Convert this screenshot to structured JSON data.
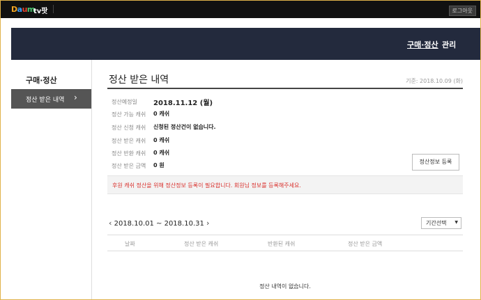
{
  "topbar": {
    "logo_parts": [
      "D",
      "a",
      "u",
      "m"
    ],
    "service_name": "tv팟",
    "logout_label": "로그아웃"
  },
  "header": {
    "nav": [
      "구매·정산",
      "관리"
    ]
  },
  "sidebar": {
    "title": "구매·정산",
    "items": [
      {
        "label": "정산 받은 내역",
        "chevron": "›"
      }
    ]
  },
  "main": {
    "title": "정산 받은 내역",
    "ref_date": "기준: 2018.10.09 (화)",
    "info": [
      {
        "label": "정산예정일",
        "value": "2018.11.12 (월)"
      },
      {
        "label": "정산 가능 캐쉬",
        "value": "0 캐쉬"
      },
      {
        "label": "정산 신청 캐쉬",
        "value": "신청된 정산건이 없습니다."
      },
      {
        "label": "정산 받은 캐쉬",
        "value": "0 캐쉬"
      },
      {
        "label": "정산 반환 캐쉬",
        "value": "0 캐쉬"
      },
      {
        "label": "정산 받은 금액",
        "value": "0 원"
      }
    ],
    "register_button": "정산정보 등록",
    "notice": "후원 캐쉬 정산을 위해 정산정보 등록이 필요합니다. 회원님 정보를 등록해주세요.",
    "period": {
      "prev": "‹",
      "text": "2018.10.01 ~ 2018.10.31",
      "next": "›"
    },
    "period_select": "기간선택",
    "columns": [
      "날짜",
      "정산 받은 캐쉬",
      "반환된 캐쉬",
      "정산 받은 금액"
    ],
    "empty_message": "정산 내역이 없습니다."
  },
  "colors": {
    "header_bg": "#232a3d",
    "active_menu_bg": "#555555",
    "notice_text": "#d9302c"
  }
}
